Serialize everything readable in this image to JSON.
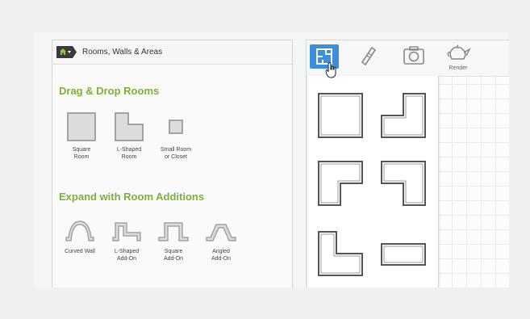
{
  "left_panel": {
    "header": {
      "icon": "home-dropdown-icon",
      "title": "Rooms, Walls & Areas"
    },
    "sections": [
      {
        "heading": "Drag & Drop Rooms",
        "items": [
          {
            "icon": "square-room-icon",
            "label_line1": "Square",
            "label_line2": "Room"
          },
          {
            "icon": "l-shaped-room-icon",
            "label_line1": "L-Shaped",
            "label_line2": "Room"
          },
          {
            "icon": "small-room-icon",
            "label_line1": "Small Room",
            "label_line2": "or Closet"
          }
        ]
      },
      {
        "heading": "Expand with Room Additions",
        "items": [
          {
            "icon": "curved-wall-icon",
            "label_line1": "Curved Wall",
            "label_line2": ""
          },
          {
            "icon": "l-shaped-addon-icon",
            "label_line1": "L-Shaped",
            "label_line2": "Add-On"
          },
          {
            "icon": "square-addon-icon",
            "label_line1": "Square",
            "label_line2": "Add-On"
          },
          {
            "icon": "angled-addon-icon",
            "label_line1": "Angled",
            "label_line2": "Add-On"
          }
        ]
      }
    ]
  },
  "right_panel": {
    "toolbar": [
      {
        "icon": "floorplan-icon",
        "active": true,
        "label": ""
      },
      {
        "icon": "ruler-icon",
        "active": false,
        "label": ""
      },
      {
        "icon": "camera-icon",
        "active": false,
        "label": ""
      },
      {
        "icon": "teapot-icon",
        "active": false,
        "label": "Render"
      }
    ],
    "dropdown_shapes": [
      "square-room-shape",
      "l-shape-room-shape",
      "l-shape-flipped-shape",
      "l-shape-inverted-shape",
      "l-shape-tall-shape",
      "rectangle-room-shape"
    ]
  },
  "colors": {
    "accent_green": "#7bb13a",
    "active_tool_blue": "#3e8fd9"
  }
}
